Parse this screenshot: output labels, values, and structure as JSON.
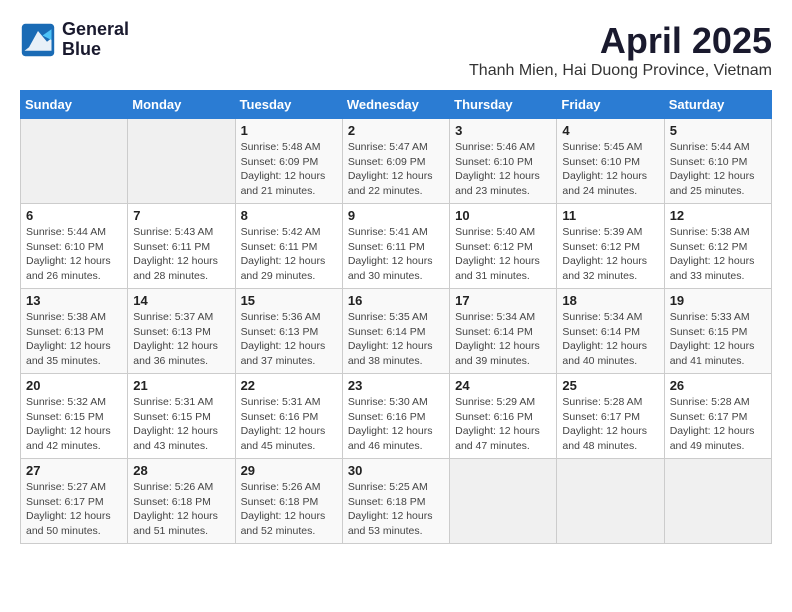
{
  "header": {
    "logo_line1": "General",
    "logo_line2": "Blue",
    "month_year": "April 2025",
    "location": "Thanh Mien, Hai Duong Province, Vietnam"
  },
  "weekdays": [
    "Sunday",
    "Monday",
    "Tuesday",
    "Wednesday",
    "Thursday",
    "Friday",
    "Saturday"
  ],
  "weeks": [
    [
      {
        "day": "",
        "info": ""
      },
      {
        "day": "",
        "info": ""
      },
      {
        "day": "1",
        "info": "Sunrise: 5:48 AM\nSunset: 6:09 PM\nDaylight: 12 hours\nand 21 minutes."
      },
      {
        "day": "2",
        "info": "Sunrise: 5:47 AM\nSunset: 6:09 PM\nDaylight: 12 hours\nand 22 minutes."
      },
      {
        "day": "3",
        "info": "Sunrise: 5:46 AM\nSunset: 6:10 PM\nDaylight: 12 hours\nand 23 minutes."
      },
      {
        "day": "4",
        "info": "Sunrise: 5:45 AM\nSunset: 6:10 PM\nDaylight: 12 hours\nand 24 minutes."
      },
      {
        "day": "5",
        "info": "Sunrise: 5:44 AM\nSunset: 6:10 PM\nDaylight: 12 hours\nand 25 minutes."
      }
    ],
    [
      {
        "day": "6",
        "info": "Sunrise: 5:44 AM\nSunset: 6:10 PM\nDaylight: 12 hours\nand 26 minutes."
      },
      {
        "day": "7",
        "info": "Sunrise: 5:43 AM\nSunset: 6:11 PM\nDaylight: 12 hours\nand 28 minutes."
      },
      {
        "day": "8",
        "info": "Sunrise: 5:42 AM\nSunset: 6:11 PM\nDaylight: 12 hours\nand 29 minutes."
      },
      {
        "day": "9",
        "info": "Sunrise: 5:41 AM\nSunset: 6:11 PM\nDaylight: 12 hours\nand 30 minutes."
      },
      {
        "day": "10",
        "info": "Sunrise: 5:40 AM\nSunset: 6:12 PM\nDaylight: 12 hours\nand 31 minutes."
      },
      {
        "day": "11",
        "info": "Sunrise: 5:39 AM\nSunset: 6:12 PM\nDaylight: 12 hours\nand 32 minutes."
      },
      {
        "day": "12",
        "info": "Sunrise: 5:38 AM\nSunset: 6:12 PM\nDaylight: 12 hours\nand 33 minutes."
      }
    ],
    [
      {
        "day": "13",
        "info": "Sunrise: 5:38 AM\nSunset: 6:13 PM\nDaylight: 12 hours\nand 35 minutes."
      },
      {
        "day": "14",
        "info": "Sunrise: 5:37 AM\nSunset: 6:13 PM\nDaylight: 12 hours\nand 36 minutes."
      },
      {
        "day": "15",
        "info": "Sunrise: 5:36 AM\nSunset: 6:13 PM\nDaylight: 12 hours\nand 37 minutes."
      },
      {
        "day": "16",
        "info": "Sunrise: 5:35 AM\nSunset: 6:14 PM\nDaylight: 12 hours\nand 38 minutes."
      },
      {
        "day": "17",
        "info": "Sunrise: 5:34 AM\nSunset: 6:14 PM\nDaylight: 12 hours\nand 39 minutes."
      },
      {
        "day": "18",
        "info": "Sunrise: 5:34 AM\nSunset: 6:14 PM\nDaylight: 12 hours\nand 40 minutes."
      },
      {
        "day": "19",
        "info": "Sunrise: 5:33 AM\nSunset: 6:15 PM\nDaylight: 12 hours\nand 41 minutes."
      }
    ],
    [
      {
        "day": "20",
        "info": "Sunrise: 5:32 AM\nSunset: 6:15 PM\nDaylight: 12 hours\nand 42 minutes."
      },
      {
        "day": "21",
        "info": "Sunrise: 5:31 AM\nSunset: 6:15 PM\nDaylight: 12 hours\nand 43 minutes."
      },
      {
        "day": "22",
        "info": "Sunrise: 5:31 AM\nSunset: 6:16 PM\nDaylight: 12 hours\nand 45 minutes."
      },
      {
        "day": "23",
        "info": "Sunrise: 5:30 AM\nSunset: 6:16 PM\nDaylight: 12 hours\nand 46 minutes."
      },
      {
        "day": "24",
        "info": "Sunrise: 5:29 AM\nSunset: 6:16 PM\nDaylight: 12 hours\nand 47 minutes."
      },
      {
        "day": "25",
        "info": "Sunrise: 5:28 AM\nSunset: 6:17 PM\nDaylight: 12 hours\nand 48 minutes."
      },
      {
        "day": "26",
        "info": "Sunrise: 5:28 AM\nSunset: 6:17 PM\nDaylight: 12 hours\nand 49 minutes."
      }
    ],
    [
      {
        "day": "27",
        "info": "Sunrise: 5:27 AM\nSunset: 6:17 PM\nDaylight: 12 hours\nand 50 minutes."
      },
      {
        "day": "28",
        "info": "Sunrise: 5:26 AM\nSunset: 6:18 PM\nDaylight: 12 hours\nand 51 minutes."
      },
      {
        "day": "29",
        "info": "Sunrise: 5:26 AM\nSunset: 6:18 PM\nDaylight: 12 hours\nand 52 minutes."
      },
      {
        "day": "30",
        "info": "Sunrise: 5:25 AM\nSunset: 6:18 PM\nDaylight: 12 hours\nand 53 minutes."
      },
      {
        "day": "",
        "info": ""
      },
      {
        "day": "",
        "info": ""
      },
      {
        "day": "",
        "info": ""
      }
    ]
  ]
}
